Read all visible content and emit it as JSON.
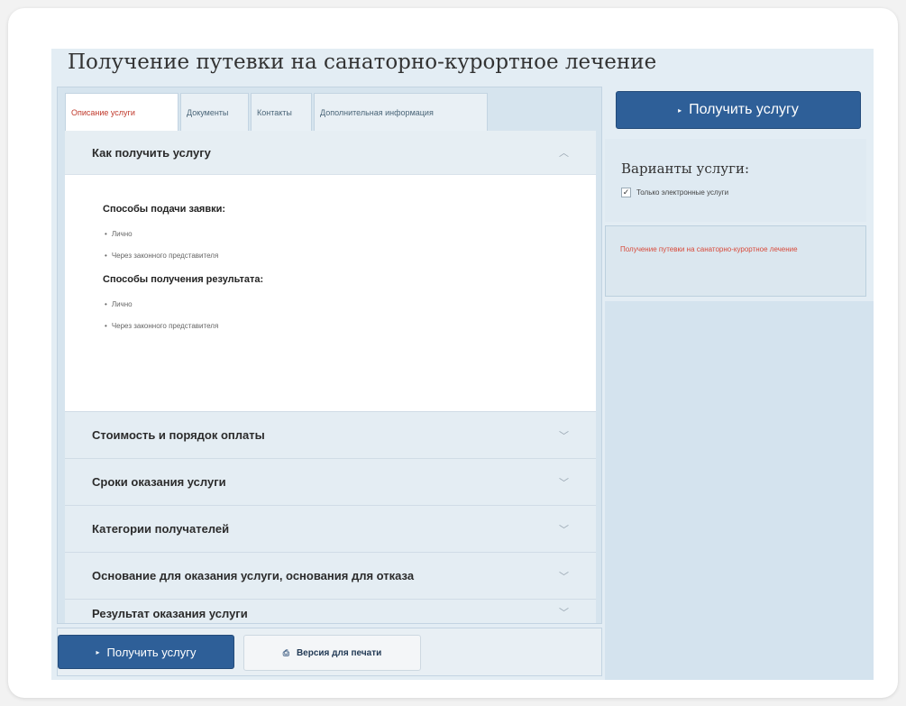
{
  "page_title": "Получение путевки на санаторно-курортное лечение",
  "tabs": [
    {
      "label": "Описание услуги",
      "active": true
    },
    {
      "label": "Документы",
      "active": false
    },
    {
      "label": "Контакты",
      "active": false
    },
    {
      "label": "Дополнительная информация",
      "active": false
    }
  ],
  "accordion": {
    "open_section": {
      "title": "Как получить услугу",
      "submit_heading": "Способы подачи заявки:",
      "submit_items": [
        "Лично",
        "Через законного представителя"
      ],
      "result_heading": "Способы получения результата:",
      "result_items": [
        "Лично",
        "Через законного представителя"
      ]
    },
    "sections": [
      "Стоимость и порядок оплаты",
      "Сроки оказания услуги",
      "Категории получателей",
      "Основание для оказания услуги, основания для отказа",
      "Результат оказания услуги"
    ]
  },
  "footer": {
    "get_service_label": "Получить услугу",
    "print_label": "Версия для печати"
  },
  "sidebar": {
    "get_service_label": "Получить услугу",
    "variants_title": "Варианты услуги:",
    "only_electronic_label": "Только электронные услуги",
    "only_electronic_checked": true,
    "related_link": "Получение путевки на санаторно-курортное лечение"
  },
  "icons": {
    "arrow": "▸",
    "chevron_up": "︿",
    "chevron_down": "﹀",
    "check": "✓",
    "print": "⎙"
  },
  "colors": {
    "primary_button": "#2e5f98",
    "active_tab_text": "#c0392b",
    "related_link": "#d84a3a"
  }
}
